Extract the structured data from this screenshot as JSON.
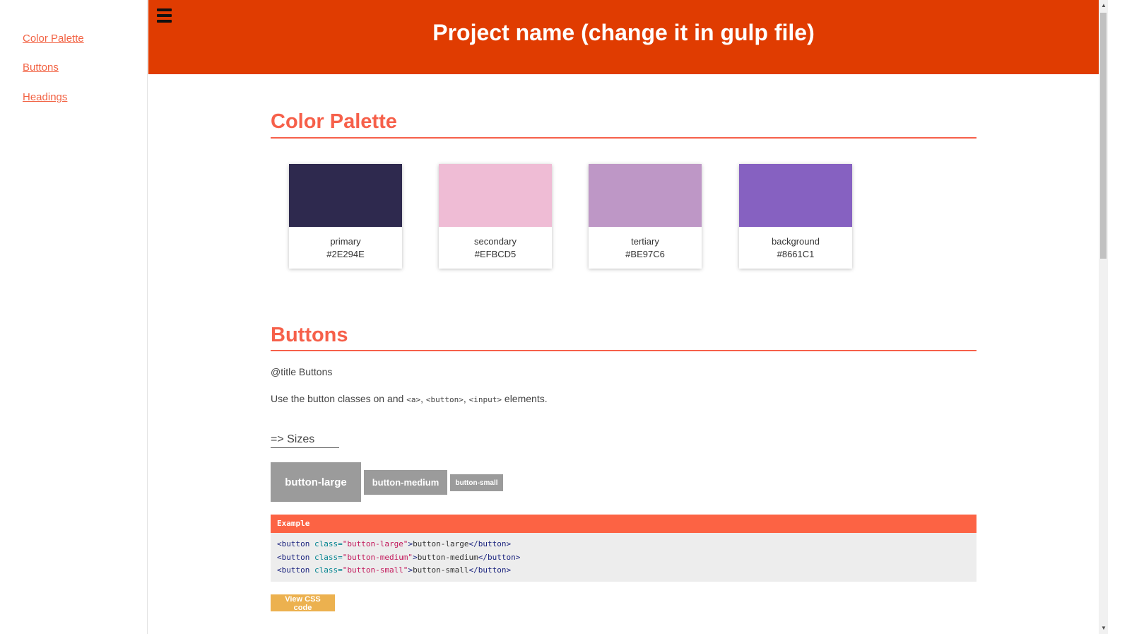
{
  "sidebar": {
    "links": [
      "Color Palette",
      "Buttons",
      "Headings"
    ]
  },
  "header": {
    "title": "Project name (change it in gulp file)",
    "menu_icon": "hamburger-icon"
  },
  "colors": {
    "accent": "#f6604a",
    "header_bg": "#e03c01",
    "button_grey": "#9b9b9b",
    "css_button": "#ecb14f"
  },
  "palette": {
    "title": "Color Palette",
    "swatches": [
      {
        "name": "primary",
        "hex": "#2E294E"
      },
      {
        "name": "secondary",
        "hex": "#EFBCD5"
      },
      {
        "name": "tertiary",
        "hex": "#BE97C6"
      },
      {
        "name": "background",
        "hex": "#8661C1"
      }
    ]
  },
  "buttons_section": {
    "title": "Buttons",
    "title_note": "@title Buttons",
    "usage_prefix": "Use the button classes on and ",
    "tags": [
      "<a>",
      "<button>",
      "<input>"
    ],
    "sep": ", ",
    "usage_suffix": " elements.",
    "sizes_heading": "=> Sizes",
    "buttons": {
      "large": "button-large",
      "medium": "button-medium",
      "small": "button-small"
    },
    "example_label": "Example",
    "code_lines": [
      {
        "open": "<button",
        "attr": " class=",
        "val": "\"button-large\"",
        "gt": ">",
        "text": "button-large",
        "close": "</button>"
      },
      {
        "open": "<button",
        "attr": " class=",
        "val": "\"button-medium\"",
        "gt": ">",
        "text": "button-medium",
        "close": "</button>"
      },
      {
        "open": "<button",
        "attr": " class=",
        "val": "\"button-small\"",
        "gt": ">",
        "text": "button-small",
        "close": "</button>"
      }
    ],
    "view_css_label": "View CSS code"
  },
  "scrollbar": {
    "up_icon": "▲",
    "down_icon": "▼"
  }
}
